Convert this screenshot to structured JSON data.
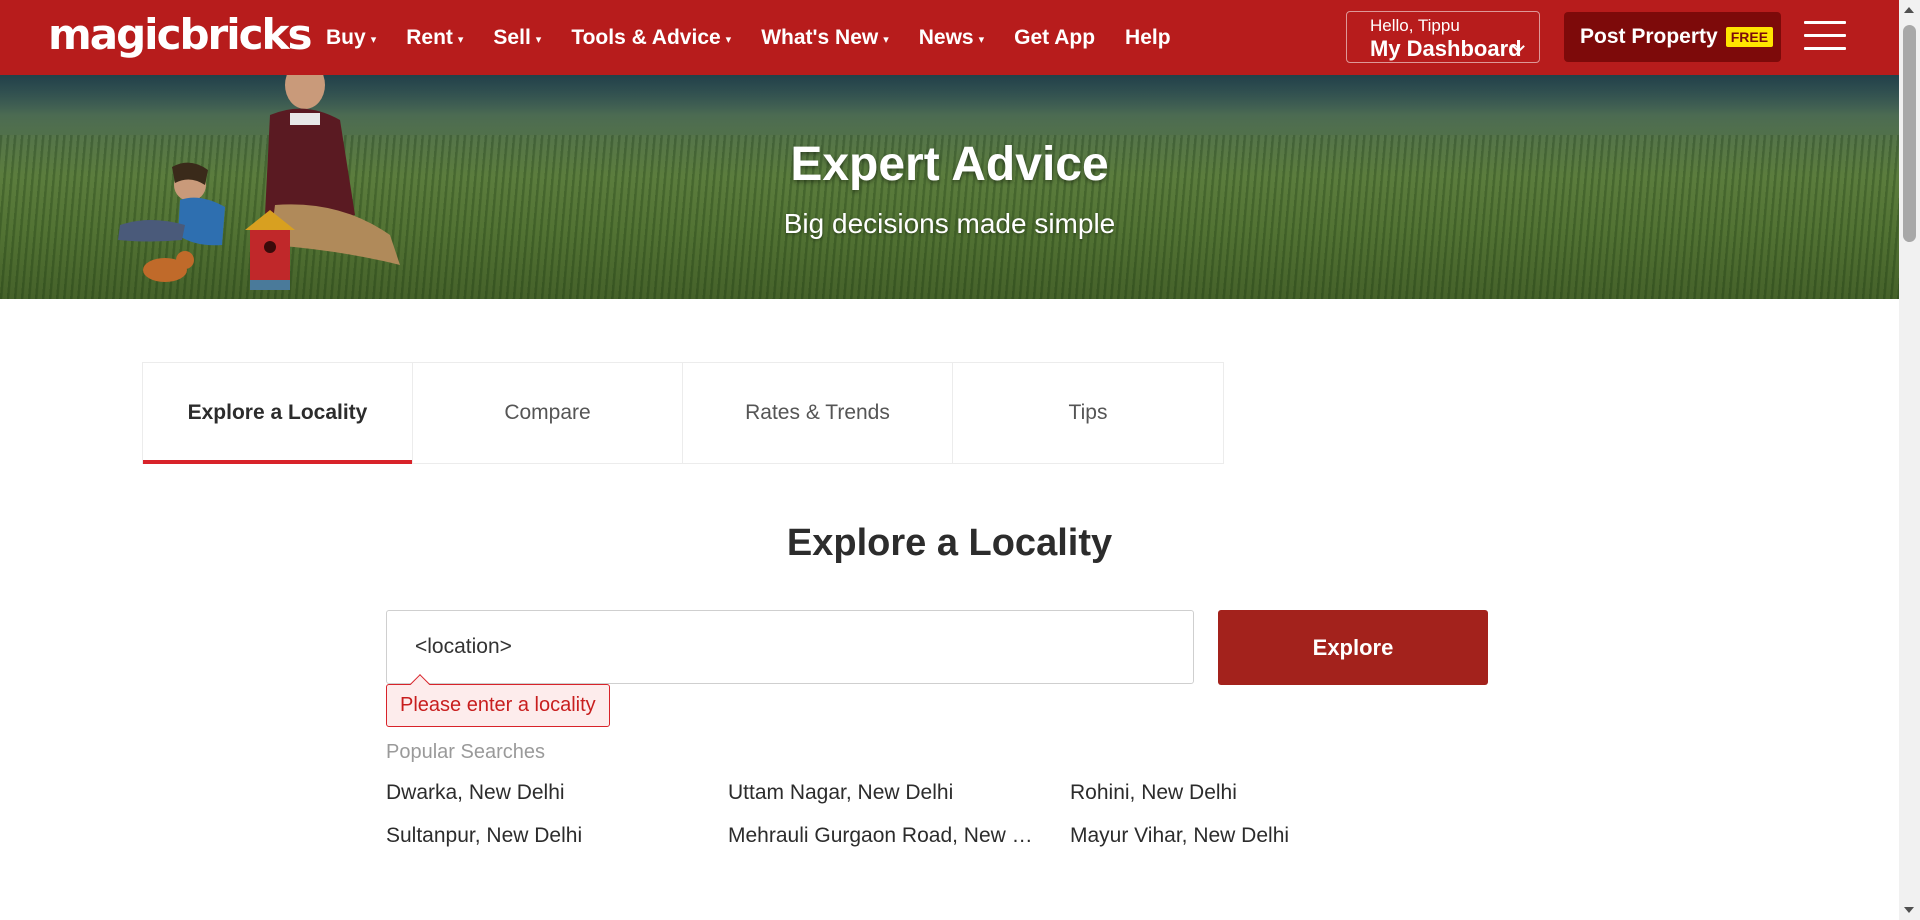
{
  "header": {
    "logo": "magicbricks",
    "nav": [
      {
        "label": "Buy",
        "has_caret": true
      },
      {
        "label": "Rent",
        "has_caret": true
      },
      {
        "label": "Sell",
        "has_caret": true
      },
      {
        "label": "Tools & Advice",
        "has_caret": true
      },
      {
        "label": "What's New",
        "has_caret": true
      },
      {
        "label": "News",
        "has_caret": true
      },
      {
        "label": "Get App",
        "has_caret": false
      },
      {
        "label": "Help",
        "has_caret": false
      }
    ],
    "greeting": "Hello, Tippu",
    "dashboard_label": "My Dashboard",
    "post_property_label": "Post Property",
    "free_badge": "FREE",
    "menu_icon": "hamburger-menu-icon"
  },
  "hero": {
    "title": "Expert Advice",
    "subtitle": "Big decisions made simple"
  },
  "tabs": [
    {
      "label": "Explore a Locality",
      "active": true
    },
    {
      "label": "Compare",
      "active": false
    },
    {
      "label": "Rates & Trends",
      "active": false
    },
    {
      "label": "Tips",
      "active": false
    }
  ],
  "main": {
    "title": "Explore a Locality",
    "search_value": "<location>",
    "explore_button": "Explore",
    "error_message": "Please enter a locality",
    "popular_label": "Popular Searches",
    "popular_searches": [
      "Dwarka, New Delhi",
      "Uttam Nagar, New Delhi",
      "Rohini, New Delhi",
      "Sultanpur, New Delhi",
      "Mehrauli Gurgaon Road, New Delhi",
      "Mayur Vihar, New Delhi"
    ]
  },
  "colors": {
    "brand_red": "#b71c1c",
    "post_button": "#7d0a0a",
    "explore_button": "#a3221c",
    "active_tab_underline": "#d8232a",
    "free_badge": "#ffe500"
  }
}
